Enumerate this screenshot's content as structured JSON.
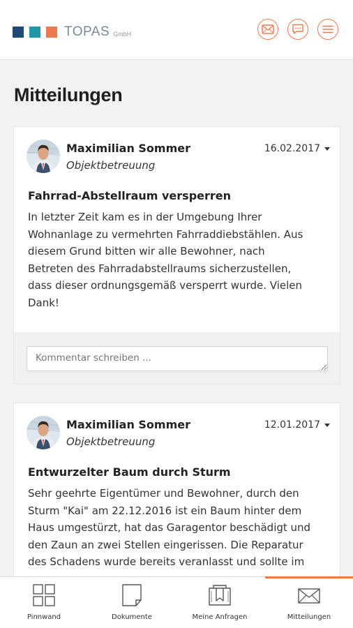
{
  "header": {
    "brand": "TOPAS",
    "brand_suffix": "GmbH",
    "logo_colors": [
      "#1e4a73",
      "#2196a8",
      "#ec7a50"
    ],
    "accent": "#ec7a50",
    "icons": [
      "mail-icon",
      "chat-icon",
      "menu-icon"
    ]
  },
  "page": {
    "title": "Mitteilungen"
  },
  "posts": [
    {
      "author": "Maximilian Sommer",
      "role": "Objektbetreuung",
      "date": "16.02.2017",
      "title": "Fahrrad-Abstellraum versperren",
      "body_lines": [
        "In letzter Zeit kam es in der Umgebung Ihrer",
        "Wohnanlage zu vermehrten Fahrraddiebstählen. Aus",
        "diesem Grund bitten wir alle Bewohner, nach",
        "Betreten des Fahrradabstellraums sicherzustellen,",
        "dass dieser ordnungsgemäß versperrt wurde. Vielen",
        "Dank!"
      ],
      "comment_placeholder": "Kommentar schreiben ..."
    },
    {
      "author": "Maximilian Sommer",
      "role": "Objektbetreuung",
      "date": "12.01.2017",
      "title": "Entwurzelter Baum durch Sturm",
      "body_lines": [
        "Sehr geehrte Eigentümer und Bewohner, durch den",
        "Sturm \"Kai\" am 22.12.2016 ist ein Baum hinter dem",
        "Haus umgestürzt, hat das Garagentor beschädigt und",
        "den Zaun an zwei Stellen eingerissen. Die Reparatur",
        "des Schadens wurde bereits veranlasst und sollte im"
      ]
    }
  ],
  "tabs": [
    {
      "label": "Pinnwand",
      "icon": "grid-icon"
    },
    {
      "label": "Dokumente",
      "icon": "document-icon"
    },
    {
      "label": "Meine Anfragen",
      "icon": "requests-icon"
    },
    {
      "label": "Mitteilungen",
      "icon": "envelope-icon",
      "active": true
    }
  ]
}
